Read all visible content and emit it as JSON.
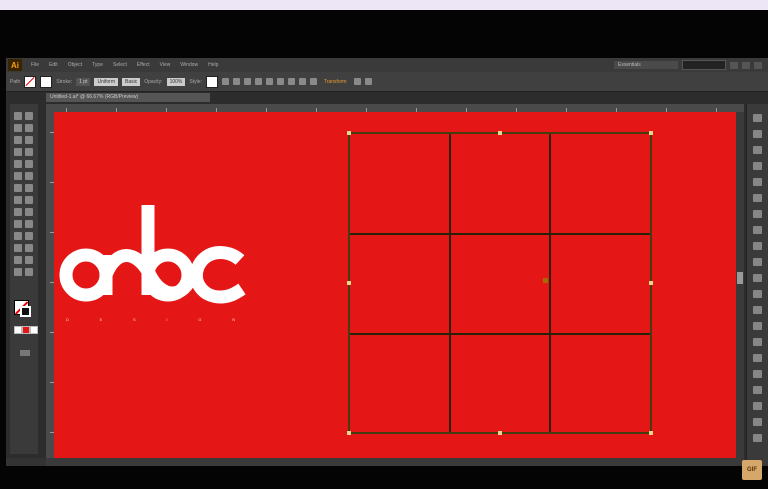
{
  "app": {
    "logo_text": "Ai"
  },
  "menu": {
    "items": [
      "File",
      "Edit",
      "Object",
      "Type",
      "Select",
      "Effect",
      "View",
      "Window",
      "Help"
    ],
    "workspace": "Essentials"
  },
  "control_bar": {
    "selection_label": "Path",
    "stroke_label": "Stroke:",
    "stroke_value": "1 pt",
    "variable_width": "Uniform",
    "brush": "Basic",
    "opacity_label": "Opacity:",
    "opacity_value": "100%",
    "style_label": "Style:",
    "transform_label": "Transform"
  },
  "document": {
    "tab_title": "Untitled-1.ai* @ 66.67% (RGB/Preview)"
  },
  "canvas": {
    "background_color": "#e41616",
    "grid_rows": 3,
    "grid_cols": 3
  },
  "logo": {
    "letters": "abc",
    "tagline": [
      "D",
      "E",
      "S",
      "I",
      "G",
      "N"
    ]
  },
  "watermark": {
    "text": "GIF"
  },
  "colors": {
    "accent": "#f3a21a",
    "selection": "#463c10"
  }
}
